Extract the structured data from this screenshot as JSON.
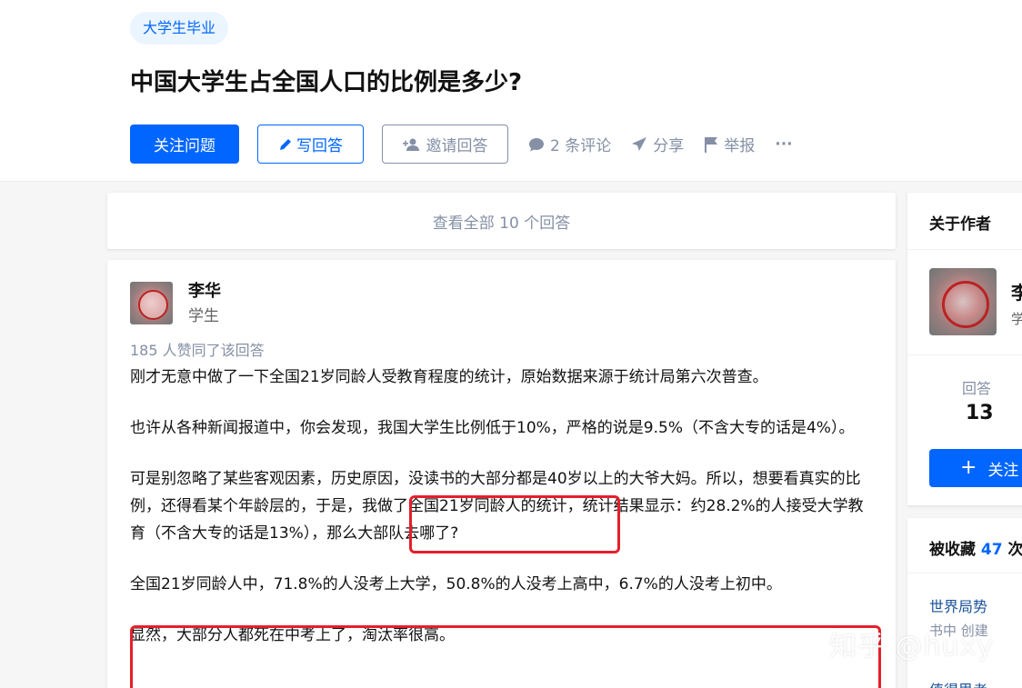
{
  "topic_tag": "大学生毕业",
  "question_title": "中国大学生占全国人口的比例是多少?",
  "actions": {
    "follow_question": "关注问题",
    "write_answer": "写回答",
    "invite_answer": "邀请回答",
    "comments": "2 条评论",
    "share": "分享",
    "report": "举报",
    "more": "···"
  },
  "view_all": "查看全部 10 个回答",
  "answer": {
    "author_name": "李华",
    "author_bio": "学生",
    "votes_text": "185 人赞同了该回答",
    "paragraphs": [
      "刚才无意中做了一下全国21岁同龄人受教育程度的统计，原始数据来源于统计局第六次普查。",
      "也许从各种新闻报道中，你会发现，我国大学生比例低于10%，严格的说是9.5%（不含大专的话是4%）。",
      "可是别忽略了某些客观因素，历史原因，没读书的大部分都是40岁以上的大爷大妈。所以，想要看真实的比例，还得看某个年龄层的，于是，我做了全国21岁同龄人的统计，统计结果显示：约28.2%的人接受大学教育（不含大专的话是13%），那么大部队去哪了?",
      "全国21岁同龄人中，71.8%的人没考上大学，50.8%的人没考上高中，6.7%的人没考上初中。",
      "显然，大部分人都死在中考上了，淘汰率很高。"
    ]
  },
  "sidebar": {
    "about_author_title": "关于作者",
    "author_name_partial": "李",
    "author_bio_partial": "学",
    "answers_label": "回答",
    "answers_count": "13",
    "follow_label": "关注",
    "collections_title": "被收藏",
    "collections_count": "47",
    "collections_suffix": "次",
    "collection_item_1": "世界局势",
    "collection_item_1_sub": "书中 创建",
    "collection_item_2": "值得思考"
  },
  "watermark": "知乎 @huxy",
  "colors": {
    "brand_blue": "#0066ff",
    "highlight_red": "#e51f2b",
    "muted_gray": "#8590a6"
  }
}
